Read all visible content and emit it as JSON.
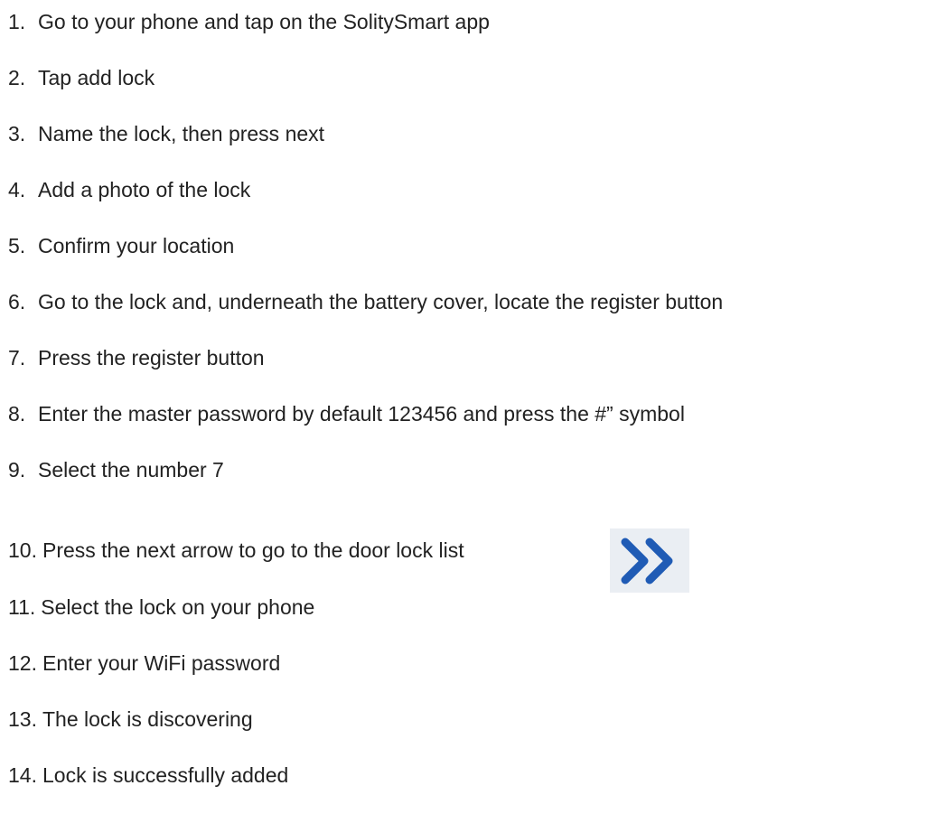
{
  "steps": [
    {
      "number": "1.",
      "text": "Go to your phone and tap on the SolitySmart app"
    },
    {
      "number": "2.",
      "text": "Tap add lock"
    },
    {
      "number": "3.",
      "text": "Name the lock, then press next"
    },
    {
      "number": "4.",
      "text": "Add a photo of the lock"
    },
    {
      "number": "5.",
      "text": "Confirm your location"
    },
    {
      "number": "6.",
      "text": "Go to the lock and, underneath the battery cover, locate the register button"
    },
    {
      "number": "7.",
      "text": "Press the register button"
    },
    {
      "number": "8.",
      "text": "Enter the master password by default 123456 and press the #” symbol"
    },
    {
      "number": "9.",
      "text": "Select the number 7"
    },
    {
      "number": "10.",
      "text": "Press the next arrow to go to the door lock list"
    },
    {
      "number": "11.",
      "text": "Select the lock on your phone"
    },
    {
      "number": "12.",
      "text": "Enter your WiFi password"
    },
    {
      "number": "13.",
      "text": "The lock is discovering"
    },
    {
      "number": "14.",
      "text": "Lock is successfully added"
    }
  ],
  "next_arrow": {
    "icon": "double-chevron-right-icon",
    "color": "#1f5bb5",
    "background": "#eaeef3"
  }
}
